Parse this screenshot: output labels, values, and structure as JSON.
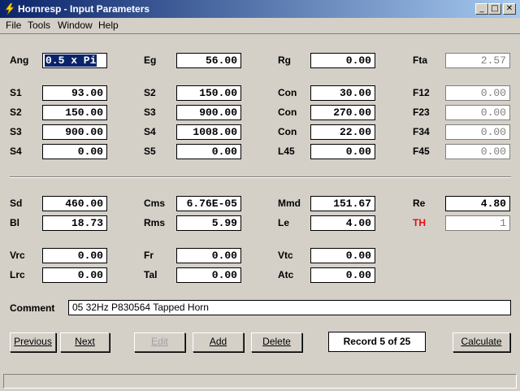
{
  "window": {
    "title": "Hornresp - Input Parameters",
    "controls": {
      "minimize": "_",
      "maximize": "□",
      "close": "✕"
    }
  },
  "menu": [
    "File",
    "Tools",
    "Window",
    "Help"
  ],
  "params": {
    "ang": {
      "label": "Ang",
      "value": "0.5 x Pi"
    },
    "eg": {
      "label": "Eg",
      "value": "56.00"
    },
    "rg": {
      "label": "Rg",
      "value": "0.00"
    },
    "fta": {
      "label": "Fta",
      "value": "2.57"
    },
    "s1": {
      "label": "S1",
      "value": "93.00"
    },
    "s2a": {
      "label": "S2",
      "value": "150.00"
    },
    "con1": {
      "label": "Con",
      "value": "30.00"
    },
    "f12": {
      "label": "F12",
      "value": "0.00"
    },
    "s2b": {
      "label": "S2",
      "value": "150.00"
    },
    "s3a": {
      "label": "S3",
      "value": "900.00"
    },
    "con2": {
      "label": "Con",
      "value": "270.00"
    },
    "f23": {
      "label": "F23",
      "value": "0.00"
    },
    "s3b": {
      "label": "S3",
      "value": "900.00"
    },
    "s4a": {
      "label": "S4",
      "value": "1008.00"
    },
    "con3": {
      "label": "Con",
      "value": "22.00"
    },
    "f34": {
      "label": "F34",
      "value": "0.00"
    },
    "s4b": {
      "label": "S4",
      "value": "0.00"
    },
    "s5": {
      "label": "S5",
      "value": "0.00"
    },
    "l45": {
      "label": "L45",
      "value": "0.00"
    },
    "f45": {
      "label": "F45",
      "value": "0.00"
    },
    "sd": {
      "label": "Sd",
      "value": "460.00"
    },
    "cms": {
      "label": "Cms",
      "value": "6.76E-05"
    },
    "mmd": {
      "label": "Mmd",
      "value": "151.67"
    },
    "re": {
      "label": "Re",
      "value": "4.80"
    },
    "bl": {
      "label": "Bl",
      "value": "18.73"
    },
    "rms": {
      "label": "Rms",
      "value": "5.99"
    },
    "le": {
      "label": "Le",
      "value": "4.00"
    },
    "th": {
      "label": "TH",
      "value": "1",
      "label_color": "#e01010"
    },
    "vrc": {
      "label": "Vrc",
      "value": "0.00"
    },
    "fr": {
      "label": "Fr",
      "value": "0.00"
    },
    "vtc": {
      "label": "Vtc",
      "value": "0.00"
    },
    "lrc": {
      "label": "Lrc",
      "value": "0.00"
    },
    "tal": {
      "label": "Tal",
      "value": "0.00"
    },
    "atc": {
      "label": "Atc",
      "value": "0.00"
    }
  },
  "comment": {
    "label": "Comment",
    "value": "05   32Hz P830564 Tapped Horn"
  },
  "buttons": {
    "previous": "Previous",
    "next": "Next",
    "edit": "Edit",
    "add": "Add",
    "delete": "Delete",
    "calculate": "Calculate"
  },
  "record": "Record 5 of 25",
  "colors": {
    "titlebar_start": "#0a246a",
    "titlebar_end": "#a6caf0",
    "face": "#d4d0c8",
    "th_label": "#e01010"
  }
}
